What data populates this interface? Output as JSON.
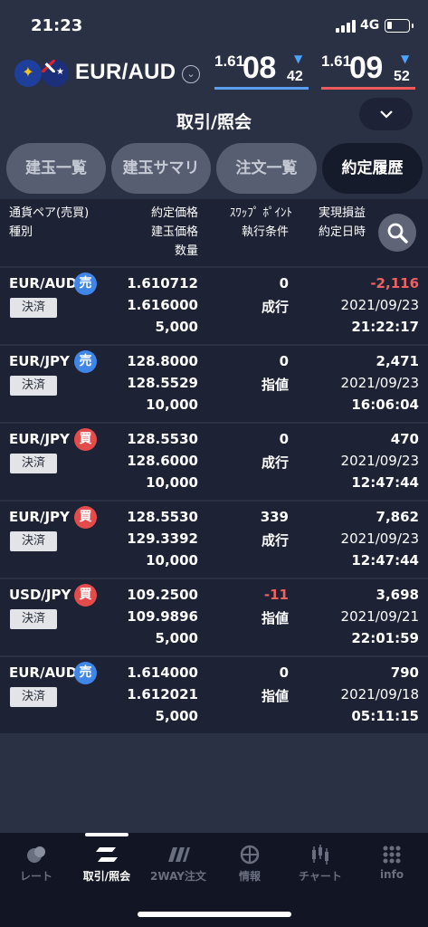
{
  "status_bar": {
    "time": "21:23",
    "network": "4G"
  },
  "header": {
    "pair": "EUR/AUD",
    "bid": {
      "prefix": "1.61",
      "big": "08",
      "pip": "42"
    },
    "ask": {
      "prefix": "1.61",
      "big": "09",
      "pip": "52"
    },
    "title": "取引/照会"
  },
  "tabs": [
    {
      "label": "建玉一覧",
      "active": false
    },
    {
      "label": "建玉サマリ",
      "active": false
    },
    {
      "label": "注文一覧",
      "active": false
    },
    {
      "label": "約定履歴",
      "active": true
    }
  ],
  "list_header": {
    "col1": [
      "通貨ペア(売買)",
      "種別"
    ],
    "col2": [
      "約定価格",
      "建玉価格",
      "数量"
    ],
    "col3": [
      "ｽﾜｯﾌﾟ ﾎﾟｲﾝﾄ",
      "執行条件"
    ],
    "col4": [
      "実現損益",
      "約定日時"
    ]
  },
  "rows": [
    {
      "pair": "EUR/AUD",
      "side": "売",
      "side_type": "sell",
      "type": "決済",
      "exec_price": "1.610712",
      "position_price": "1.616000",
      "quantity": "5,000",
      "swap": "0",
      "condition": "成行",
      "pnl": "-2,116",
      "date": "2021/09/23",
      "time": "21:22:17"
    },
    {
      "pair": "EUR/JPY",
      "side": "売",
      "side_type": "sell",
      "type": "決済",
      "exec_price": "128.8000",
      "position_price": "128.5529",
      "quantity": "10,000",
      "swap": "0",
      "condition": "指値",
      "pnl": "2,471",
      "date": "2021/09/23",
      "time": "16:06:04"
    },
    {
      "pair": "EUR/JPY",
      "side": "買",
      "side_type": "buy",
      "type": "決済",
      "exec_price": "128.5530",
      "position_price": "128.6000",
      "quantity": "10,000",
      "swap": "0",
      "condition": "成行",
      "pnl": "470",
      "date": "2021/09/23",
      "time": "12:47:44"
    },
    {
      "pair": "EUR/JPY",
      "side": "買",
      "side_type": "buy",
      "type": "決済",
      "exec_price": "128.5530",
      "position_price": "129.3392",
      "quantity": "10,000",
      "swap": "339",
      "condition": "成行",
      "pnl": "7,862",
      "date": "2021/09/23",
      "time": "12:47:44"
    },
    {
      "pair": "USD/JPY",
      "side": "買",
      "side_type": "buy",
      "type": "決済",
      "exec_price": "109.2500",
      "position_price": "109.9896",
      "quantity": "5,000",
      "swap": "-11",
      "condition": "指値",
      "pnl": "3,698",
      "date": "2021/09/21",
      "time": "22:01:59"
    },
    {
      "pair": "EUR/AUD",
      "side": "売",
      "side_type": "sell",
      "type": "決済",
      "exec_price": "1.614000",
      "position_price": "1.612021",
      "quantity": "5,000",
      "swap": "0",
      "condition": "指値",
      "pnl": "790",
      "date": "2021/09/18",
      "time": "05:11:15"
    }
  ],
  "bottom_nav": [
    {
      "label": "レート",
      "icon": "rate-icon",
      "active": false
    },
    {
      "label": "取引/照会",
      "icon": "trade-icon",
      "active": true
    },
    {
      "label": "2WAY注文",
      "icon": "two-way-icon",
      "active": false
    },
    {
      "label": "情報",
      "icon": "info-globe-icon",
      "active": false
    },
    {
      "label": "チャート",
      "icon": "chart-icon",
      "active": false
    },
    {
      "label": "info",
      "icon": "grid-icon",
      "active": false
    }
  ],
  "colors": {
    "background": "#2b3145",
    "row": "#1d2234",
    "sell": "#3f86e8",
    "buy": "#e44c4c",
    "negative": "#f06161"
  }
}
